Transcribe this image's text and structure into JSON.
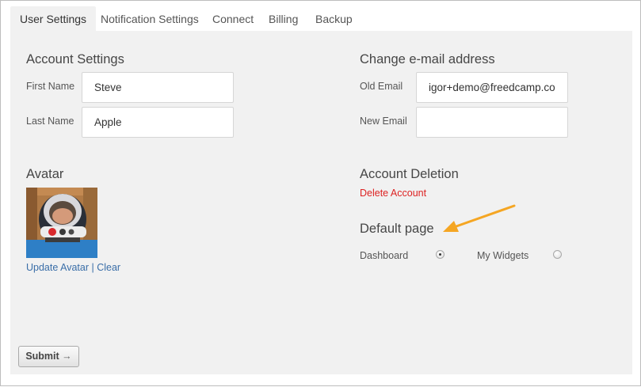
{
  "tabs": [
    {
      "label": "User Settings",
      "active": true
    },
    {
      "label": "Notification Settings",
      "active": false
    },
    {
      "label": "Connect",
      "active": false
    },
    {
      "label": "Billing",
      "active": false
    },
    {
      "label": "Backup",
      "active": false
    }
  ],
  "account": {
    "heading": "Account Settings",
    "first_name_label": "First Name",
    "first_name_value": "Steve",
    "last_name_label": "Last Name",
    "last_name_value": "Apple"
  },
  "email": {
    "heading": "Change e-mail address",
    "old_label": "Old Email",
    "old_value": "igor+demo@freedcamp.com",
    "new_label": "New Email",
    "new_value": ""
  },
  "avatar": {
    "heading": "Avatar",
    "update_link": "Update Avatar",
    "separator": "|",
    "clear_link": "Clear"
  },
  "deletion": {
    "heading": "Account Deletion",
    "delete_link": "Delete Account"
  },
  "default_page": {
    "heading": "Default page",
    "options": [
      {
        "label": "Dashboard",
        "selected": true
      },
      {
        "label": "My Widgets",
        "selected": false
      }
    ]
  },
  "submit": {
    "label": "Submit",
    "arrow": "→"
  },
  "colors": {
    "panel_bg": "#f1f1f1",
    "link_blue": "#3a6ea8",
    "link_red": "#dd2222",
    "annotation_arrow": "#f5a623"
  }
}
